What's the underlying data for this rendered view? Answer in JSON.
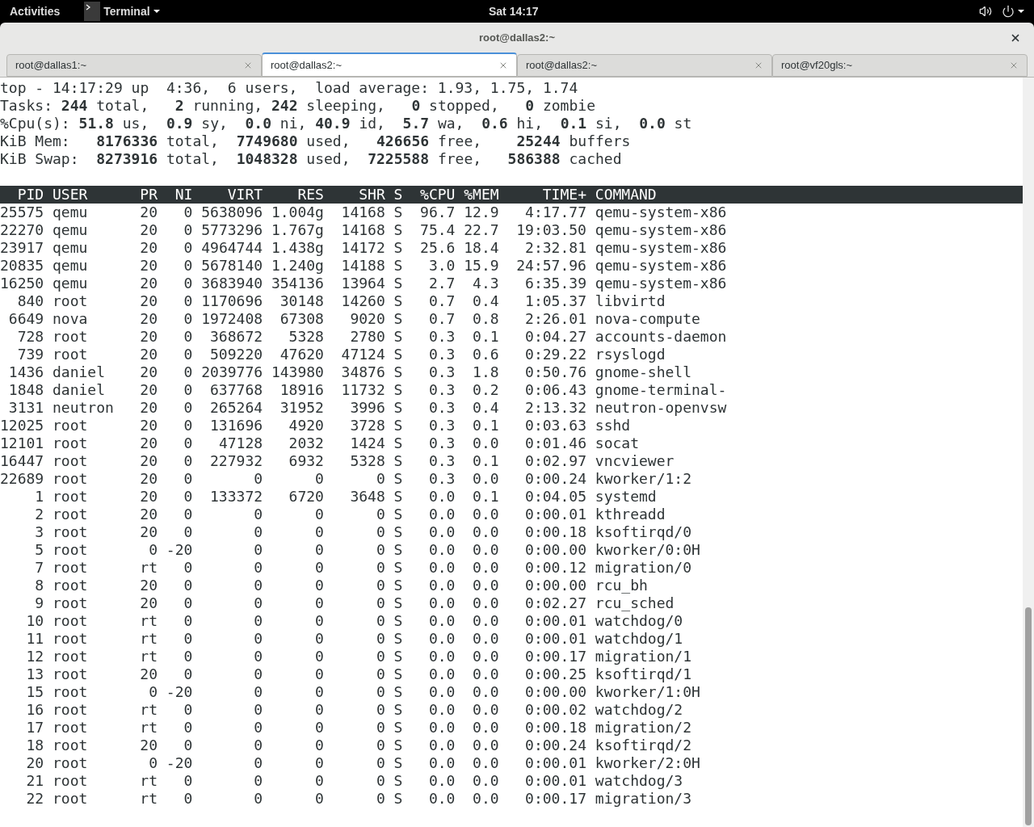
{
  "top_bar": {
    "activities": "Activities",
    "app_menu": "Terminal",
    "clock": "Sat 14:17"
  },
  "window": {
    "title": "root@dallas2:~"
  },
  "tabs": [
    {
      "label": "root@dallas1:~",
      "selected": false
    },
    {
      "label": "root@dallas2:~",
      "selected": true
    },
    {
      "label": "root@dallas2:~",
      "selected": false
    },
    {
      "label": "root@vf20gls:~",
      "selected": false
    }
  ],
  "summary": [
    "top - 14:17:29 up  4:36,  6 users,  load average: 1.93, 1.75, 1.74",
    "Tasks: **244** total,   **2** running, **242** sleeping,   **0** stopped,   **0** zombie",
    "%Cpu(s): **51.8** us,  **0.9** sy,  **0.0** ni, **40.9** id,  **5.7** wa,  **0.6** hi,  **0.1** si,  **0.0** st",
    "KiB Mem:   **8176336** total,  **7749680** used,   **426656** free,    **25244** buffers",
    "KiB Swap:  **8273916** total,  **1048328** used,  **7225588** free,   **586388** cached"
  ],
  "table": {
    "columns": [
      "PID",
      "USER",
      "PR",
      "NI",
      "VIRT",
      "RES",
      "SHR",
      "S",
      "%CPU",
      "%MEM",
      "TIME+",
      "COMMAND"
    ],
    "rows": [
      [
        "25575",
        "qemu",
        "20",
        "0",
        "5638096",
        "1.004g",
        "14168",
        "S",
        "96.7",
        "12.9",
        "4:17.77",
        "qemu-system-x86"
      ],
      [
        "22270",
        "qemu",
        "20",
        "0",
        "5773296",
        "1.767g",
        "14168",
        "S",
        "75.4",
        "22.7",
        "19:03.50",
        "qemu-system-x86"
      ],
      [
        "23917",
        "qemu",
        "20",
        "0",
        "4964744",
        "1.438g",
        "14172",
        "S",
        "25.6",
        "18.4",
        "2:32.81",
        "qemu-system-x86"
      ],
      [
        "20835",
        "qemu",
        "20",
        "0",
        "5678140",
        "1.240g",
        "14188",
        "S",
        "3.0",
        "15.9",
        "24:57.96",
        "qemu-system-x86"
      ],
      [
        "16250",
        "qemu",
        "20",
        "0",
        "3683940",
        "354136",
        "13964",
        "S",
        "2.7",
        "4.3",
        "6:35.39",
        "qemu-system-x86"
      ],
      [
        "840",
        "root",
        "20",
        "0",
        "1170696",
        "30148",
        "14260",
        "S",
        "0.7",
        "0.4",
        "1:05.37",
        "libvirtd"
      ],
      [
        "6649",
        "nova",
        "20",
        "0",
        "1972408",
        "67308",
        "9020",
        "S",
        "0.7",
        "0.8",
        "2:26.01",
        "nova-compute"
      ],
      [
        "728",
        "root",
        "20",
        "0",
        "368672",
        "5328",
        "2780",
        "S",
        "0.3",
        "0.1",
        "0:04.27",
        "accounts-daemon"
      ],
      [
        "739",
        "root",
        "20",
        "0",
        "509220",
        "47620",
        "47124",
        "S",
        "0.3",
        "0.6",
        "0:29.22",
        "rsyslogd"
      ],
      [
        "1436",
        "daniel",
        "20",
        "0",
        "2039776",
        "143980",
        "34876",
        "S",
        "0.3",
        "1.8",
        "0:50.76",
        "gnome-shell"
      ],
      [
        "1848",
        "daniel",
        "20",
        "0",
        "637768",
        "18916",
        "11732",
        "S",
        "0.3",
        "0.2",
        "0:06.43",
        "gnome-terminal-"
      ],
      [
        "3131",
        "neutron",
        "20",
        "0",
        "265264",
        "31952",
        "3996",
        "S",
        "0.3",
        "0.4",
        "2:13.32",
        "neutron-openvsw"
      ],
      [
        "12025",
        "root",
        "20",
        "0",
        "131696",
        "4920",
        "3728",
        "S",
        "0.3",
        "0.1",
        "0:03.63",
        "sshd"
      ],
      [
        "12101",
        "root",
        "20",
        "0",
        "47128",
        "2032",
        "1424",
        "S",
        "0.3",
        "0.0",
        "0:01.46",
        "socat"
      ],
      [
        "16447",
        "root",
        "20",
        "0",
        "227932",
        "6932",
        "5328",
        "S",
        "0.3",
        "0.1",
        "0:02.97",
        "vncviewer"
      ],
      [
        "22689",
        "root",
        "20",
        "0",
        "0",
        "0",
        "0",
        "S",
        "0.3",
        "0.0",
        "0:00.24",
        "kworker/1:2"
      ],
      [
        "1",
        "root",
        "20",
        "0",
        "133372",
        "6720",
        "3648",
        "S",
        "0.0",
        "0.1",
        "0:04.05",
        "systemd"
      ],
      [
        "2",
        "root",
        "20",
        "0",
        "0",
        "0",
        "0",
        "S",
        "0.0",
        "0.0",
        "0:00.01",
        "kthreadd"
      ],
      [
        "3",
        "root",
        "20",
        "0",
        "0",
        "0",
        "0",
        "S",
        "0.0",
        "0.0",
        "0:00.18",
        "ksoftirqd/0"
      ],
      [
        "5",
        "root",
        "0",
        "-20",
        "0",
        "0",
        "0",
        "S",
        "0.0",
        "0.0",
        "0:00.00",
        "kworker/0:0H"
      ],
      [
        "7",
        "root",
        "rt",
        "0",
        "0",
        "0",
        "0",
        "S",
        "0.0",
        "0.0",
        "0:00.12",
        "migration/0"
      ],
      [
        "8",
        "root",
        "20",
        "0",
        "0",
        "0",
        "0",
        "S",
        "0.0",
        "0.0",
        "0:00.00",
        "rcu_bh"
      ],
      [
        "9",
        "root",
        "20",
        "0",
        "0",
        "0",
        "0",
        "S",
        "0.0",
        "0.0",
        "0:02.27",
        "rcu_sched"
      ],
      [
        "10",
        "root",
        "rt",
        "0",
        "0",
        "0",
        "0",
        "S",
        "0.0",
        "0.0",
        "0:00.01",
        "watchdog/0"
      ],
      [
        "11",
        "root",
        "rt",
        "0",
        "0",
        "0",
        "0",
        "S",
        "0.0",
        "0.0",
        "0:00.01",
        "watchdog/1"
      ],
      [
        "12",
        "root",
        "rt",
        "0",
        "0",
        "0",
        "0",
        "S",
        "0.0",
        "0.0",
        "0:00.17",
        "migration/1"
      ],
      [
        "13",
        "root",
        "20",
        "0",
        "0",
        "0",
        "0",
        "S",
        "0.0",
        "0.0",
        "0:00.25",
        "ksoftirqd/1"
      ],
      [
        "15",
        "root",
        "0",
        "-20",
        "0",
        "0",
        "0",
        "S",
        "0.0",
        "0.0",
        "0:00.00",
        "kworker/1:0H"
      ],
      [
        "16",
        "root",
        "rt",
        "0",
        "0",
        "0",
        "0",
        "S",
        "0.0",
        "0.0",
        "0:00.02",
        "watchdog/2"
      ],
      [
        "17",
        "root",
        "rt",
        "0",
        "0",
        "0",
        "0",
        "S",
        "0.0",
        "0.0",
        "0:00.18",
        "migration/2"
      ],
      [
        "18",
        "root",
        "20",
        "0",
        "0",
        "0",
        "0",
        "S",
        "0.0",
        "0.0",
        "0:00.24",
        "ksoftirqd/2"
      ],
      [
        "20",
        "root",
        "0",
        "-20",
        "0",
        "0",
        "0",
        "S",
        "0.0",
        "0.0",
        "0:00.01",
        "kworker/2:0H"
      ],
      [
        "21",
        "root",
        "rt",
        "0",
        "0",
        "0",
        "0",
        "S",
        "0.0",
        "0.0",
        "0:00.01",
        "watchdog/3"
      ],
      [
        "22",
        "root",
        "rt",
        "0",
        "0",
        "0",
        "0",
        "S",
        "0.0",
        "0.0",
        "0:00.17",
        "migration/3"
      ]
    ]
  }
}
